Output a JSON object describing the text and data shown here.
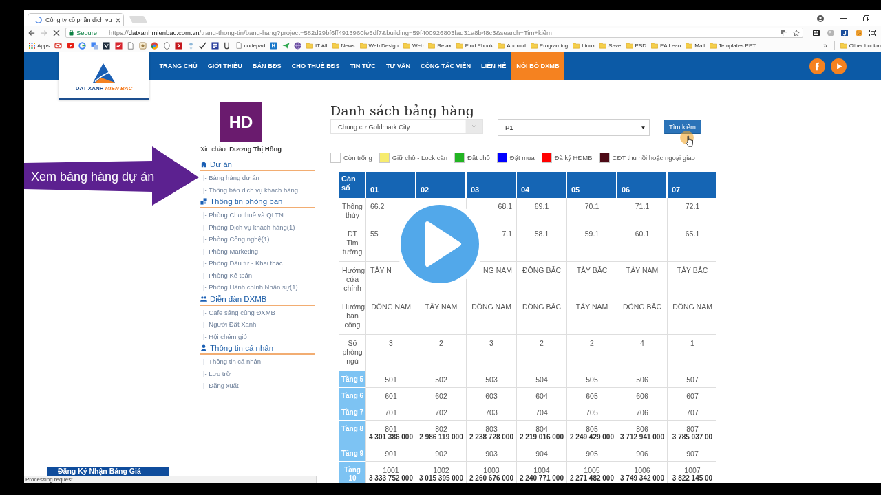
{
  "browser": {
    "loading": true,
    "tab": {
      "title": "Công ty cổ phần dịch vụ"
    },
    "address_bar": {
      "security": "Secure",
      "url_scheme": "https://",
      "url_host": "datxanhmienbac.com.vn",
      "url_rest": "/trang-thong-tin/bang-hang?project=582d29bf6ff4913960fe5df7&building=59f400926803fad31a8b48c3&search=Tim+kiếm"
    },
    "bookmarks": [
      {
        "label": "Apps",
        "kind": "apps"
      },
      {
        "label": "codepad",
        "kind": "page"
      },
      {
        "label": "IT All",
        "kind": "folder"
      },
      {
        "label": "News",
        "kind": "folder"
      },
      {
        "label": "Web Design",
        "kind": "folder"
      },
      {
        "label": "Web",
        "kind": "folder"
      },
      {
        "label": "Relax",
        "kind": "folder"
      },
      {
        "label": "Find Ebook",
        "kind": "folder"
      },
      {
        "label": "Android",
        "kind": "folder"
      },
      {
        "label": "Programing",
        "kind": "folder"
      },
      {
        "label": "Linux",
        "kind": "folder"
      },
      {
        "label": "Save",
        "kind": "folder"
      },
      {
        "label": "PSD",
        "kind": "folder"
      },
      {
        "label": "EA Lean",
        "kind": "folder"
      },
      {
        "label": "Mail",
        "kind": "folder"
      },
      {
        "label": "Templates PPT",
        "kind": "folder"
      }
    ],
    "bookmarks_overflow": "»",
    "other_bookmarks": "Other bookm"
  },
  "header": {
    "logo": {
      "main": "DAT XANH",
      "accent": "MIEN BAC"
    },
    "nav": [
      {
        "label": "TRANG CHỦ",
        "selected": false
      },
      {
        "label": "GIỚI THIỆU",
        "selected": false
      },
      {
        "label": "BÁN BĐS",
        "selected": false
      },
      {
        "label": "CHO THUÊ BĐS",
        "selected": false
      },
      {
        "label": "TIN TỨC",
        "selected": false
      },
      {
        "label": "TƯ VẤN",
        "selected": false
      },
      {
        "label": "CỘNG TÁC VIÊN",
        "selected": false
      },
      {
        "label": "LIÊN HỆ",
        "selected": false
      },
      {
        "label": "NỘI BỘ DXMB",
        "selected": true
      }
    ]
  },
  "callout": {
    "text": "Xem bảng hàng dự án"
  },
  "sidebar": {
    "avatar_initials": "HD",
    "greeting": "Xin chào: **Dương Thị Hồng**",
    "sections": [
      {
        "title": "Dự án",
        "items": [
          "|- Bảng hàng dự án",
          "|- Thông báo dịch vụ khách hàng"
        ]
      },
      {
        "title": "Thông tin phòng ban",
        "items": [
          "|- Phòng Cho thuê và QLTN",
          "|- Phòng Dịch vụ khách hàng(1)",
          "|- Phòng Công nghệ(1)",
          "|- Phòng Marketing",
          "|- Phòng Đầu tư - Khai thác",
          "|- Phòng Kế toán",
          "|- Phòng Hành chính Nhân sự(1)"
        ]
      },
      {
        "title": "Diễn đàn DXMB",
        "items": [
          "|- Cafe sáng cùng ĐXMB",
          "|- Người Đất Xanh",
          "|- Hội chém gió"
        ]
      },
      {
        "title": "Thông tin cá nhân",
        "items": [
          "|- Thông tin cá nhân",
          "|- Lưu trữ",
          "|- Đăng xuất"
        ]
      }
    ]
  },
  "main": {
    "title": "Danh sách bảng hàng",
    "project_select": "Chung cư Goldmark City",
    "building_select": "P1",
    "search_button": "Tìm kiếm",
    "legend": [
      {
        "label": "Còn trống",
        "color": "#ffffff"
      },
      {
        "label": "Giữ chỗ - Lock căn",
        "color": "#f7ec6e"
      },
      {
        "label": "Đặt chỗ",
        "color": "#22b422"
      },
      {
        "label": "Đặt mua",
        "color": "#0000ff"
      },
      {
        "label": "Đã ký HĐMB",
        "color": "#ff0000"
      },
      {
        "label": "CĐT thu hồi hoặc ngoại giao",
        "color": "#4d0a16"
      }
    ],
    "table": {
      "columns": [
        "Căn số",
        "01",
        "02",
        "03",
        "04",
        "05",
        "06",
        "07"
      ],
      "rows": [
        {
          "kind": "info",
          "cells": [
            "Thông thủy",
            "66.2",
            null,
            "68.1",
            "69.1",
            "70.1",
            "71.1",
            "72.1"
          ]
        },
        {
          "kind": "info",
          "cells": [
            "DT Tim tường",
            "55",
            null,
            "7.1",
            "58.1",
            "59.1",
            "60.1",
            "65.1"
          ]
        },
        {
          "kind": "info",
          "cells": [
            "Hướng cửa chính",
            "TÂY N",
            null,
            "NG NAM",
            "ĐÔNG BẮC",
            "TÂY BẮC",
            "TÂY NAM",
            "TÂY BẮC"
          ]
        },
        {
          "kind": "info",
          "cells": [
            "Hướng ban công",
            "ĐÔNG NAM",
            "TÂY NAM",
            "ĐÔNG NAM",
            "ĐÔNG BẮC",
            "TÂY NAM",
            "ĐÔNG BẮC",
            "ĐÔNG NAM"
          ]
        },
        {
          "kind": "info",
          "cells": [
            "Số phòng ngủ",
            "3",
            "2",
            "3",
            "2",
            "2",
            "4",
            "1"
          ]
        },
        {
          "kind": "floor",
          "cells": [
            "Tầng 5",
            {
              "unit": "501"
            },
            {
              "unit": "502"
            },
            {
              "unit": "503"
            },
            {
              "unit": "504"
            },
            {
              "unit": "505"
            },
            {
              "unit": "506"
            },
            {
              "unit": "507"
            }
          ]
        },
        {
          "kind": "floor",
          "cells": [
            "Tầng 6",
            {
              "unit": "601"
            },
            {
              "unit": "602"
            },
            {
              "unit": "603"
            },
            {
              "unit": "604"
            },
            {
              "unit": "605"
            },
            {
              "unit": "606"
            },
            {
              "unit": "607"
            }
          ]
        },
        {
          "kind": "floor",
          "cells": [
            "Tầng 7",
            {
              "unit": "701"
            },
            {
              "unit": "702"
            },
            {
              "unit": "703"
            },
            {
              "unit": "704"
            },
            {
              "unit": "705"
            },
            {
              "unit": "706"
            },
            {
              "unit": "707"
            }
          ]
        },
        {
          "kind": "floor",
          "cells": [
            "Tầng 8",
            {
              "unit": "801",
              "price": "4 301 386 000"
            },
            {
              "unit": "802",
              "price": "2 986 119 000"
            },
            {
              "unit": "803",
              "price": "2 238 728 000"
            },
            {
              "unit": "804",
              "price": "2 219 016 000"
            },
            {
              "unit": "805",
              "price": "2 249 429 000"
            },
            {
              "unit": "806",
              "price": "3 712 941 000"
            },
            {
              "unit": "807",
              "price": "3 785 037 00"
            }
          ]
        },
        {
          "kind": "floor",
          "cells": [
            "Tầng 9",
            {
              "unit": "901"
            },
            {
              "unit": "902"
            },
            {
              "unit": "903"
            },
            {
              "unit": "904"
            },
            {
              "unit": "905"
            },
            {
              "unit": "906"
            },
            {
              "unit": "907"
            }
          ]
        },
        {
          "kind": "floor",
          "cells": [
            "Tầng 10",
            {
              "unit": "1001",
              "price": "3 333 752 000"
            },
            {
              "unit": "1002",
              "price": "3 015 395 000"
            },
            {
              "unit": "1003",
              "price": "2 260 676 000"
            },
            {
              "unit": "1004",
              "price": "2 240 771 000"
            },
            {
              "unit": "1005",
              "price": "2 271 482 000"
            },
            {
              "unit": "1006",
              "price": "3 749 342 000"
            },
            {
              "unit": "1007",
              "price": "3 822 145 00"
            }
          ]
        }
      ]
    }
  },
  "register_button": "Đăng Ký Nhận Bảng Giá",
  "status_bar": "Processing request.."
}
